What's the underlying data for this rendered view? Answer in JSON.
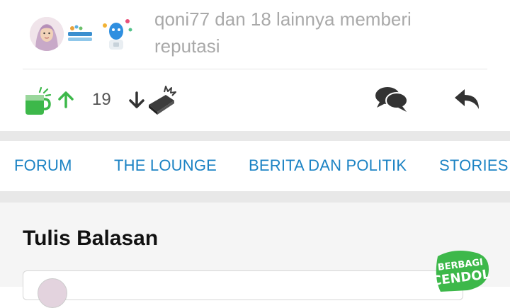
{
  "reputation": {
    "text": "qoni77 dan 18 lainnya memberi reputasi",
    "avatars": [
      "user-avatar",
      "kabar-banyuwangi-logo",
      "robot-mascot-avatar"
    ]
  },
  "actions": {
    "vote_count": "19",
    "icons": [
      "cendol-icon",
      "upvote-arrow-icon",
      "downvote-arrow-icon",
      "bata-brick-icon",
      "comment-icon",
      "reply-arrow-icon"
    ]
  },
  "nav": {
    "items": [
      "FORUM",
      "THE LOUNGE",
      "BERITA DAN POLITIK",
      "STORIES F"
    ]
  },
  "reply": {
    "title": "Tulis Balasan"
  },
  "badge": {
    "line1": "BERBAGI",
    "line2": "CENDOL"
  },
  "colors": {
    "accent_blue": "#1c83c4",
    "cendol_green": "#3db84a",
    "muted_text": "#a9a9a9"
  }
}
